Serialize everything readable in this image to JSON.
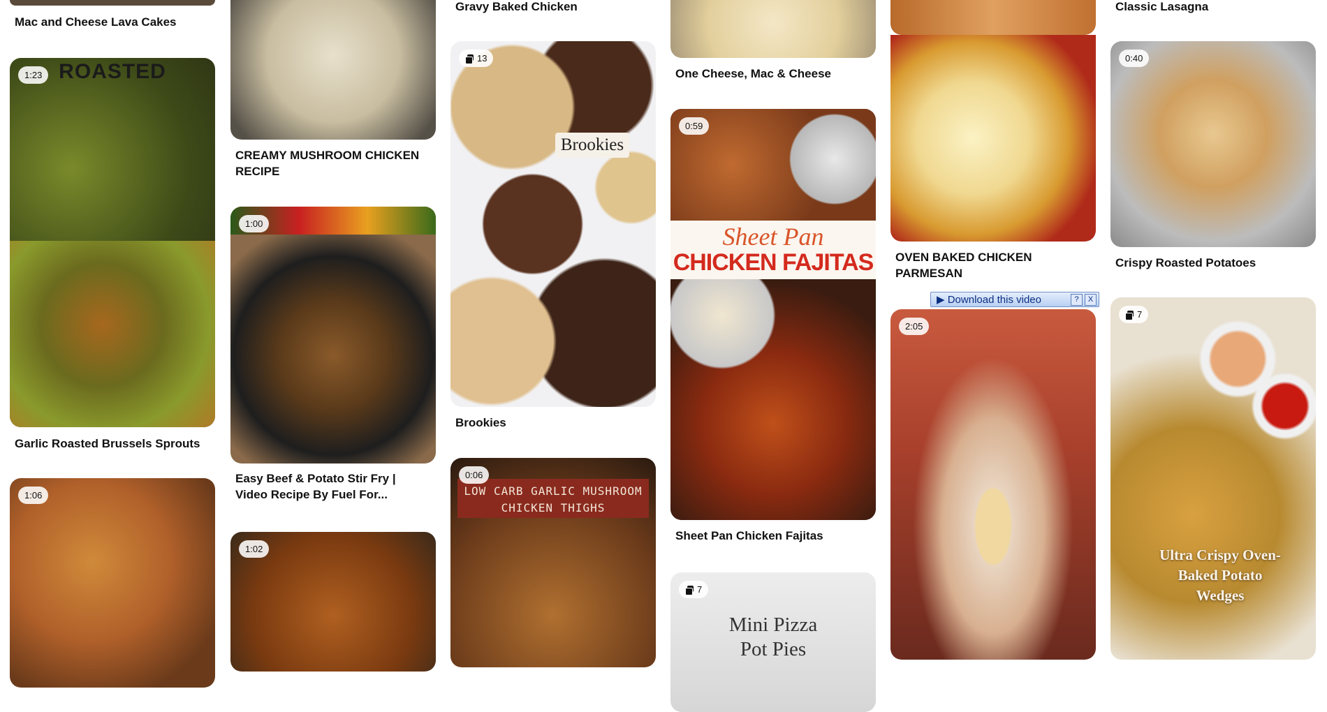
{
  "columns": [
    {
      "pins": [
        {
          "title": "Mac and Cheese Lava Cakes"
        },
        {
          "title": "Garlic Roasted Brussels Sprouts",
          "duration": "1:23",
          "overlay": "ROASTED"
        },
        {
          "title": "",
          "duration": "1:06"
        }
      ]
    },
    {
      "pins": [
        {
          "title": "CREAMY MUSHROOM CHICKEN RECIPE"
        },
        {
          "title": "Easy Beef & Potato Stir Fry | Video Recipe By Fuel For...",
          "duration": "1:00"
        },
        {
          "title": "",
          "duration": "1:02"
        }
      ]
    },
    {
      "pins": [
        {
          "title": "Gravy Baked Chicken"
        },
        {
          "title": "Brookies",
          "image_count": "13",
          "overlay": "Brookies"
        },
        {
          "title": "",
          "duration": "0:06",
          "overlay": "LOW CARB GARLIC MUSHROOM CHICKEN THIGHS"
        }
      ]
    },
    {
      "pins": [
        {
          "title": "One Cheese, Mac & Cheese"
        },
        {
          "title": "Sheet Pan Chicken Fajitas",
          "duration": "0:59",
          "overlay_line1": "Sheet Pan",
          "overlay_line2": "CHICKEN FAJITAS"
        },
        {
          "title": "",
          "image_count": "7",
          "overlay_line1": "Mini Pizza",
          "overlay_line2": "Pot Pies"
        }
      ]
    },
    {
      "pins": [
        {
          "title": ""
        },
        {
          "title": "OVEN BAKED CHICKEN PARMESAN"
        },
        {
          "title": "",
          "duration": "2:05"
        }
      ]
    },
    {
      "pins": [
        {
          "title": "Classic Lasagna"
        },
        {
          "title": "Crispy Roasted Potatoes",
          "duration": "0:40"
        },
        {
          "title": "",
          "image_count": "7",
          "overlay": "Ultra Crispy Oven-Baked Potato Wedges"
        }
      ]
    }
  ],
  "download_bar": {
    "label": "Download this video",
    "help": "?",
    "close": "X"
  },
  "icons": {
    "stack": "multiple-images-icon",
    "play": "play-icon"
  },
  "colors": {
    "background": "#ffffff",
    "title_text": "#111111",
    "badge_bg": "#ffffff",
    "fajita_red": "#d42a1e"
  }
}
